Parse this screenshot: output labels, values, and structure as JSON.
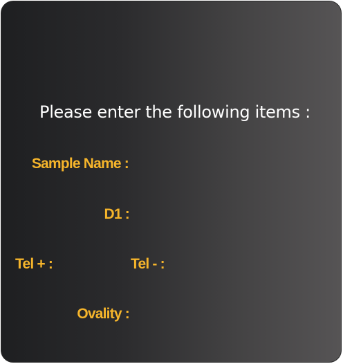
{
  "prompt": {
    "text": "Please enter the following items :"
  },
  "fields": {
    "sample_name": "Sample Name :",
    "d1": "D1 :",
    "tel_plus": "Tel + :",
    "tel_minus": "Tel - :",
    "ovality": "Ovality :"
  },
  "colors": {
    "label": "#f6b52b",
    "prompt": "#ffffff",
    "panel_left": "#1e1f21",
    "panel_right": "#565455"
  }
}
